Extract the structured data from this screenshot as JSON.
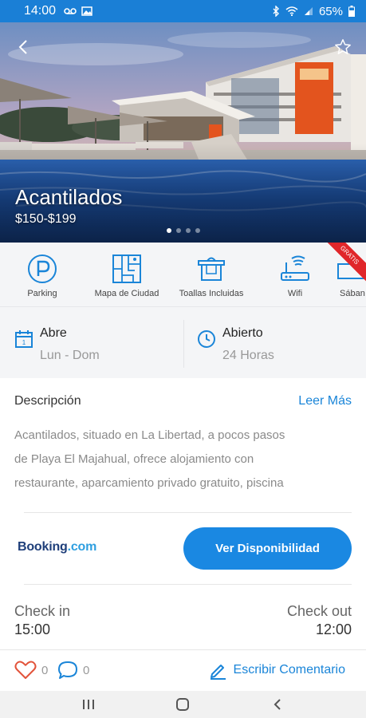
{
  "status_bar": {
    "time": "14:00",
    "battery": "65%",
    "icons": [
      "voicemail-icon",
      "image-icon",
      "bluetooth-icon",
      "wifi-icon",
      "signal-icon",
      "battery-icon"
    ]
  },
  "hero": {
    "title": "Acantilados",
    "price": "$150-$199",
    "slide_index": 1,
    "slide_count": 4
  },
  "amenities": [
    {
      "label": "Parking",
      "icon": "parking-icon"
    },
    {
      "label": "Mapa de Ciudad",
      "icon": "city-map-icon"
    },
    {
      "label": "Toallas Incluidas",
      "icon": "towels-icon"
    },
    {
      "label": "Wifi",
      "icon": "wifi-router-icon"
    },
    {
      "label": "Sában",
      "icon": "sheets-icon",
      "badge": "GRATIS"
    }
  ],
  "schedule": {
    "open": {
      "title": "Abre",
      "value": "Lun - Dom",
      "icon": "calendar-icon"
    },
    "hours": {
      "title": "Abierto",
      "value": "24 Horas",
      "icon": "clock-icon"
    }
  },
  "description": {
    "title": "Descripción",
    "read_more": "Leer Más",
    "lines": [
      "Acantilados, situado en La Libertad, a pocos pasos",
      "de Playa El Majahual, ofrece alojamiento con",
      "restaurante, aparcamiento privado gratuito, piscina"
    ]
  },
  "booking": {
    "brand": "Booking",
    "brand_suffix": ".com",
    "button": "Ver Disponibilidad"
  },
  "checkin": {
    "label": "Check in",
    "time": "15:00"
  },
  "checkout": {
    "label": "Check out",
    "time": "12:00"
  },
  "footer": {
    "likes": "0",
    "comments": "0",
    "write_comment": "Escribir Comentario"
  },
  "colors": {
    "accent": "#1a88e2",
    "status_bar": "#1a7fd6",
    "like": "#e2533a",
    "badge": "#e0262a"
  }
}
